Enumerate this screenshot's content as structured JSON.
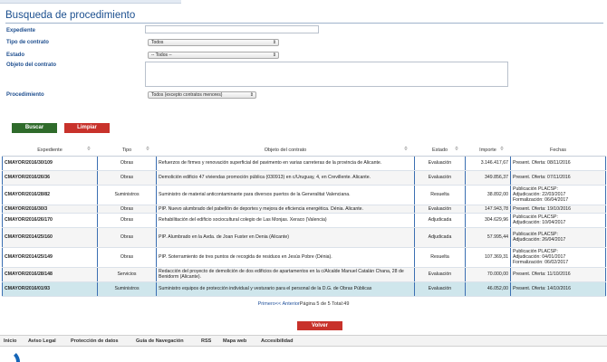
{
  "page_title": "Busqueda de procedimiento",
  "form": {
    "expediente_label": "Expediente",
    "tipo_label": "Tipo de contrato",
    "tipo_value": "Todos",
    "estado_label": "Estado",
    "estado_value": "-- Todos --",
    "objeto_label": "Objeto del contrato",
    "procedimiento_label": "Procedimiento",
    "procedimiento_value": "Todos (excepto contratos menores)"
  },
  "buttons": {
    "search": "Buscar",
    "clear": "Limpiar",
    "back": "Volver"
  },
  "table": {
    "headers": [
      "Expediente",
      "Tipo",
      "Objeto del contrato",
      "Estado",
      "Importe",
      "Fechas"
    ],
    "rows": [
      {
        "exp": "CMAYOR/2016/30/109",
        "tipo": "Obras",
        "objeto": "Refuerzos de firmes y renovación superficial del pavimento en varias carreteras de la provincia de Alicante.",
        "estado": "Evaluación",
        "importe": "3.146.417,67",
        "fechas": "Present. Oferta:   08/11/2016"
      },
      {
        "exp": "CMAYOR/2016/26/36",
        "tipo": "Obras",
        "objeto": "Demolición edificio 47 viviendas promoción pública (030913) en c/Uruguay, 4, en Crevillente. Alicante.",
        "estado": "Evaluación",
        "importe": "349.856,37",
        "fechas": "Present. Oferta:   07/11/2016"
      },
      {
        "exp": "CMAYOR/2016/28/82",
        "tipo": "Suministros",
        "objeto": "Suministro de material anticontaminante para diversos puertos de la Generalitat Valenciana.",
        "estado": "Resuelta",
        "importe": "38.892,00",
        "fechas": "Publicación PLACSP:\nAdjudicación:        22/03/2017\nFormalización:       06/04/2017"
      },
      {
        "exp": "CMAYOR/2016/30/3",
        "tipo": "Obras",
        "objeto": "PIP. Nuevo alumbrado del pabellón de deportes y mejora de eficiencia energética. Dénia. Alicante.",
        "estado": "Evaluación",
        "importe": "147.943,78",
        "fechas": "Present. Oferta:   19/10/2016"
      },
      {
        "exp": "CMAYOR/2016/26/170",
        "tipo": "Obras",
        "objeto": "Rehabilitación del edificio sociocultural colegio de Las Monjas. Xeraco (Valencia)",
        "estado": "Adjudicada",
        "importe": "304.629,96",
        "fechas": "Publicación PLACSP:\nAdjudicación:        10/04/2017"
      },
      {
        "exp": "CMAYOR/2014/25/160",
        "tipo": "Obras",
        "objeto": "PIP. Alumbrado en la Avda. de Joan Fuster en Denia (Alicante)",
        "estado": "Adjudicada",
        "importe": "57.995,44",
        "fechas": "Publicación PLACSP:\nAdjudicación:        26/04/2017"
      },
      {
        "exp": "CMAYOR/2014/25/149",
        "tipo": "Obras",
        "objeto": "PIP. Soterramiento de tres puntos de recogida de residuos en Jesús Pobre (Dénia).",
        "estado": "Resuelta",
        "importe": "107.369,31",
        "fechas": "Publicación PLACSP:\nAdjudicación:        04/01/2017\nFormalización:       06/02/2017"
      },
      {
        "exp": "CMAYOR/2016/28/148",
        "tipo": "Servicios",
        "objeto": "Redacción del proyecto de demolición de dos edificios de apartamentos en la c/Alcalde Manuel Catalán Chana, 28 de Benidorm (Alicante).",
        "estado": "Evaluación",
        "importe": "70.000,00",
        "fechas": "Present. Oferta:   11/10/2016"
      },
      {
        "exp": "CMAYOR/2016/01/93",
        "tipo": "Suministros",
        "objeto": "Suministro equipos de protección individual y vesturario para el personal de la D.G. de Obras Públicas",
        "estado": "Evaluación",
        "importe": "46.052,00",
        "fechas": "Present. Oferta:   14/10/2016"
      }
    ]
  },
  "pager": {
    "first": "Primero",
    "prev": "<< Anterior",
    "info": "Página 5 de 5 Total:49"
  },
  "footer": [
    "Inicio",
    "Aviso Legal",
    "Protección de datos",
    "Guía de Navegación",
    "RSS",
    "Mapa web",
    "Accesibilidad"
  ]
}
